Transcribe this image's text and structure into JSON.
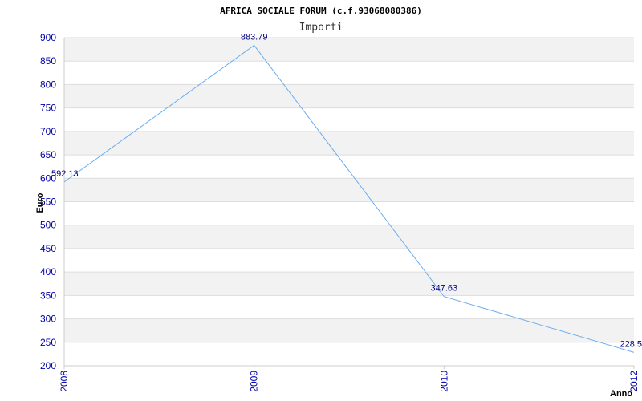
{
  "chart_data": {
    "type": "line",
    "title": "AFRICA SOCIALE FORUM (c.f.93068080386)",
    "subtitle": "Importi",
    "xlabel": "Anno",
    "ylabel": "Euro",
    "categories": [
      "2008",
      "2009",
      "2010",
      "2012"
    ],
    "series": [
      {
        "values": [
          592.13,
          883.79,
          347.63,
          228.5
        ],
        "labels": [
          "592.13",
          "883.79",
          "347.63",
          "228.5"
        ]
      }
    ],
    "ylim": [
      200,
      900
    ],
    "yticks": [
      900,
      850,
      800,
      750,
      700,
      650,
      600,
      550,
      500,
      450,
      400,
      350,
      300,
      250,
      200
    ],
    "grid": true,
    "colors": {
      "line": "#6aaef0",
      "band": "#f2f2f2",
      "grid": "#dddddd",
      "tick_text": "#0000aa",
      "label_text": "#000080"
    }
  }
}
